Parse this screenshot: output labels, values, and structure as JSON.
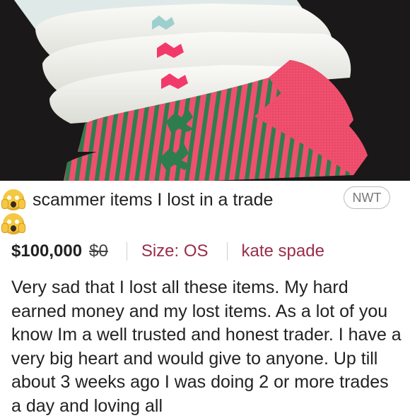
{
  "listing": {
    "title": "scammer items I lost in a trade",
    "condition_badge": "NWT",
    "price": "$100,000",
    "original_price": "$0",
    "size_label": "Size: OS",
    "brand": "kate spade",
    "description": "Very sad that I lost all these items. My hard earned money and my lost items. As a lot of you know Im a well trusted and honest trader. I have a very big heart and would give to anyone. Up till about 3 weeks ago I was doing 2 or more trades a day and loving all"
  },
  "icons": {
    "title_emoji": "screaming-face-emoji"
  },
  "colors": {
    "brand_accent": "#9a2d4a",
    "sock_pink": "#f0506e",
    "sock_green": "#2e7d4f",
    "sock_white": "#f2f2ee",
    "photo_background": "#1a1818"
  }
}
